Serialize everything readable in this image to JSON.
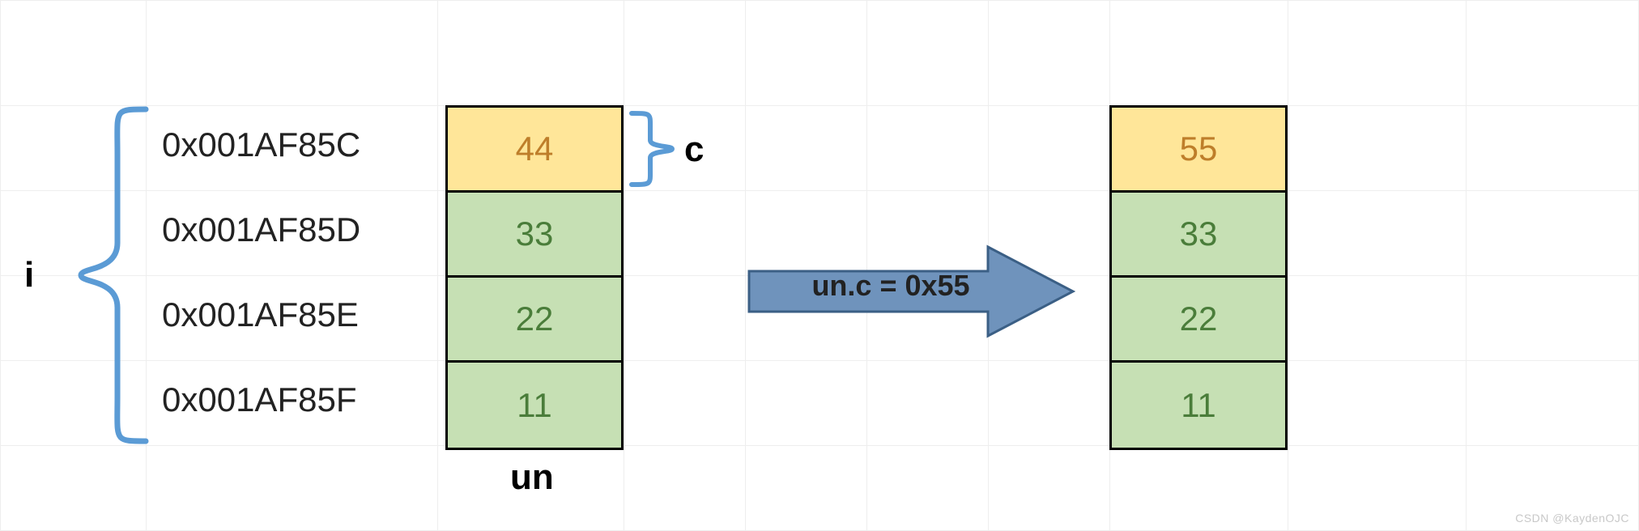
{
  "labels": {
    "i": "i",
    "c": "c",
    "un": "un"
  },
  "addresses": [
    "0x001AF85C",
    "0x001AF85D",
    "0x001AF85E",
    "0x001AF85F"
  ],
  "memory_left": {
    "cells": [
      "44",
      "33",
      "22",
      "11"
    ]
  },
  "memory_right": {
    "cells": [
      "55",
      "33",
      "22",
      "11"
    ]
  },
  "assignment": "un.c = 0x55",
  "colors": {
    "yellow_bg": "#ffe699",
    "yellow_fg": "#be7e2a",
    "green_bg": "#c6e0b4",
    "green_fg": "#4a7d3a",
    "arrow_fill": "#6f93bc",
    "arrow_stroke": "#3b5f85",
    "brace": "#5b9bd5"
  },
  "watermark": "CSDN @KaydenOJC"
}
